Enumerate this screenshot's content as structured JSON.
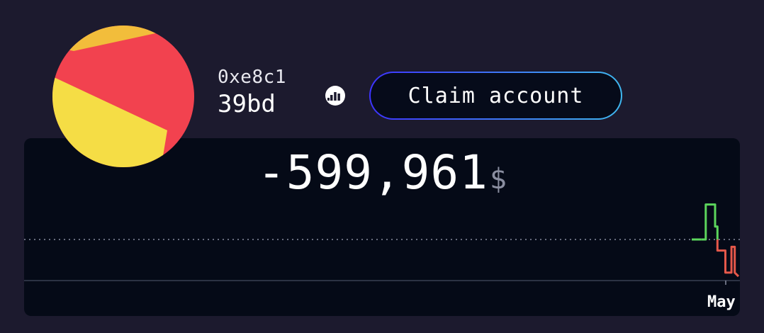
{
  "profile": {
    "address_line1": "0xe8c1",
    "address_line2": "39bd",
    "avatar_colors": [
      "#f2424f",
      "#f5dd45",
      "#f2bd3b"
    ]
  },
  "stats_icon": "chart-stats-icon",
  "claim_button": {
    "label": "Claim account",
    "gradient": [
      "#3d33ff",
      "#3fb8f0"
    ]
  },
  "balance": {
    "amount": "-599,961",
    "currency": "$"
  },
  "chart_data": {
    "type": "line",
    "x_tick_label": "May",
    "baseline_style": "dotted",
    "colors": {
      "positive": "#5cd65c",
      "negative": "#e5584a"
    },
    "segments": [
      {
        "sign": "flat",
        "points": [
          [
            0.0,
            0.0
          ],
          [
            0.2,
            0.0
          ]
        ]
      },
      {
        "sign": "positive",
        "points": [
          [
            0.2,
            0.0
          ],
          [
            0.3,
            0.0
          ],
          [
            0.3,
            0.95
          ],
          [
            0.5,
            0.95
          ],
          [
            0.5,
            0.35
          ],
          [
            0.55,
            0.35
          ],
          [
            0.55,
            0.0
          ]
        ]
      },
      {
        "sign": "negative",
        "points": [
          [
            0.55,
            0.0
          ],
          [
            0.55,
            -0.3
          ],
          [
            0.72,
            -0.3
          ],
          [
            0.72,
            -0.9
          ],
          [
            0.85,
            -0.9
          ],
          [
            0.85,
            -0.2
          ],
          [
            0.92,
            -0.2
          ],
          [
            0.92,
            -0.9
          ],
          [
            1.0,
            -1.0
          ]
        ]
      }
    ]
  }
}
